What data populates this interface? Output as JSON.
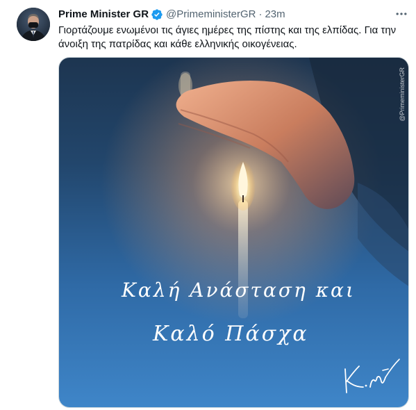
{
  "tweet": {
    "display_name": "Prime Minister GR",
    "handle": "@PrimeministerGR",
    "separator": "·",
    "time": "23m",
    "text": "Γιορτάζουμε ενωμένοι τις άγιες ημέρες της πίστης και της ελπίδας. Για την άνοιξη της πατρίδας και κάθε ελληνικής οικογένειας.",
    "verified": true,
    "verified_color": "#1d9bf0"
  },
  "media": {
    "greeting_line_1": "Καλή Ανάσταση και",
    "greeting_line_2": "Καλό Πάσχα",
    "watermark": "@PrimeministerGR",
    "signature": "K.M"
  },
  "icons": {
    "more": "more-dots-icon",
    "verified": "verified-badge-icon"
  }
}
